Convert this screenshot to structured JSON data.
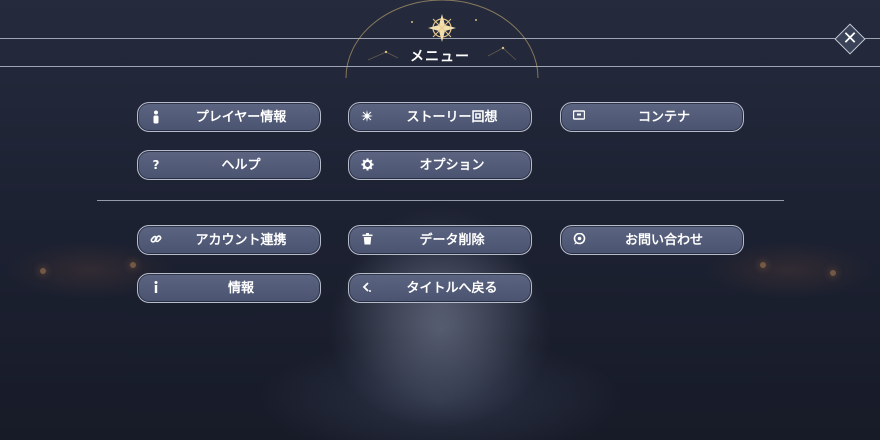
{
  "header": {
    "title": "メニュー",
    "close_label": "✕"
  },
  "menu": {
    "player_info": "プレイヤー情報",
    "story_recollection": "ストーリー回想",
    "container": "コンテナ",
    "help": "ヘルプ",
    "options": "オプション",
    "account_link": "アカウント連携",
    "data_delete": "データ削除",
    "contact": "お問い合わせ",
    "info": "情報",
    "back_to_title": "タイトルへ戻る"
  },
  "icons": {
    "player_info": "person-icon",
    "story_recollection": "star-burst-icon",
    "container": "box-icon",
    "help": "question-icon",
    "options": "gear-icon",
    "account_link": "link-icon",
    "data_delete": "trash-icon",
    "contact": "chat-icon",
    "info": "info-icon",
    "back_to_title": "back-arrow-icon"
  }
}
